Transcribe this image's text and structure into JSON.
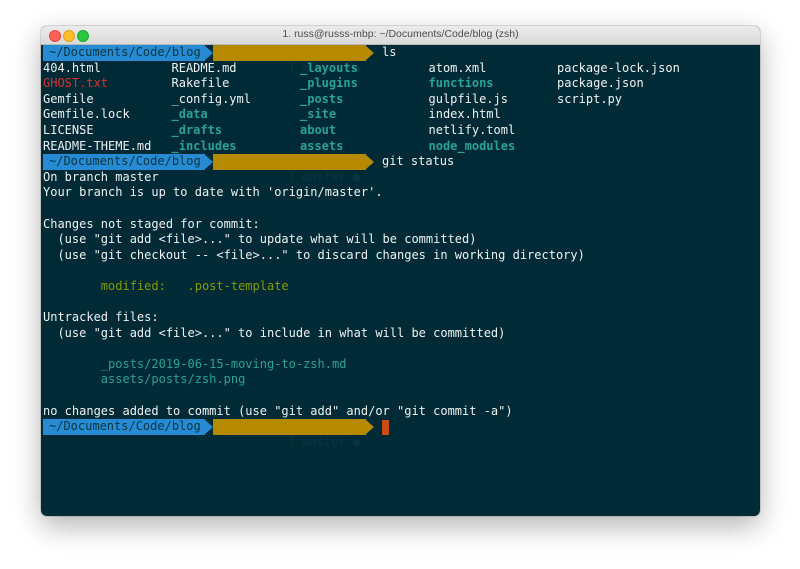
{
  "window": {
    "title": "1. russ@russs-mbp: ~/Documents/Code/blog (zsh)"
  },
  "prompt": {
    "path": "~/Documents/Code/blog",
    "branch": "master",
    "branch_icon": "",
    "dirty_marker": "●"
  },
  "commands": {
    "ls": "ls",
    "git_status": "git status"
  },
  "ls_output": {
    "rows": [
      [
        {
          "name": "404.html",
          "kind": "file"
        },
        {
          "name": "README.md",
          "kind": "file"
        },
        {
          "name": "_layouts",
          "kind": "dir"
        },
        {
          "name": "atom.xml",
          "kind": "file"
        },
        {
          "name": "package-lock.json",
          "kind": "file"
        }
      ],
      [
        {
          "name": "GHOST.txt",
          "kind": "special"
        },
        {
          "name": "Rakefile",
          "kind": "file"
        },
        {
          "name": "_plugins",
          "kind": "dir"
        },
        {
          "name": "functions",
          "kind": "dir"
        },
        {
          "name": "package.json",
          "kind": "file"
        }
      ],
      [
        {
          "name": "Gemfile",
          "kind": "file"
        },
        {
          "name": "_config.yml",
          "kind": "file"
        },
        {
          "name": "_posts",
          "kind": "dir"
        },
        {
          "name": "gulpfile.js",
          "kind": "file"
        },
        {
          "name": "script.py",
          "kind": "file"
        }
      ],
      [
        {
          "name": "Gemfile.lock",
          "kind": "file"
        },
        {
          "name": "_data",
          "kind": "dir"
        },
        {
          "name": "_site",
          "kind": "dir"
        },
        {
          "name": "index.html",
          "kind": "file"
        },
        {
          "name": "",
          "kind": "file"
        }
      ],
      [
        {
          "name": "LICENSE",
          "kind": "file"
        },
        {
          "name": "_drafts",
          "kind": "dir"
        },
        {
          "name": "about",
          "kind": "dir"
        },
        {
          "name": "netlify.toml",
          "kind": "file"
        },
        {
          "name": "",
          "kind": "file"
        }
      ],
      [
        {
          "name": "README-THEME.md",
          "kind": "file"
        },
        {
          "name": "_includes",
          "kind": "dir"
        },
        {
          "name": "assets",
          "kind": "dir"
        },
        {
          "name": "node_modules",
          "kind": "dir"
        },
        {
          "name": "",
          "kind": "file"
        }
      ]
    ]
  },
  "git_status_output": {
    "on_branch": "On branch master",
    "up_to_date": "Your branch is up to date with 'origin/master'.",
    "changes_header": "Changes not staged for commit:",
    "hint_add": "  (use \"git add <file>...\" to update what will be committed)",
    "hint_checkout": "  (use \"git checkout -- <file>...\" to discard changes in working directory)",
    "modified_line": "        modified:   .post-template",
    "untracked_header": "Untracked files:",
    "hint_untracked": "  (use \"git add <file>...\" to include in what will be committed)",
    "untracked_1": "        _posts/2019-06-15-moving-to-zsh.md",
    "untracked_2": "        assets/posts/zsh.png",
    "no_changes": "no changes added to commit (use \"git add\" and/or \"git commit -a\")"
  },
  "colors": {
    "background": "#002b36",
    "path_segment": "#268bd2",
    "git_segment": "#b58900",
    "dir": "#2aa198",
    "modified": "#859900",
    "special_file": "#dc322f",
    "cursor": "#cb4b16"
  }
}
